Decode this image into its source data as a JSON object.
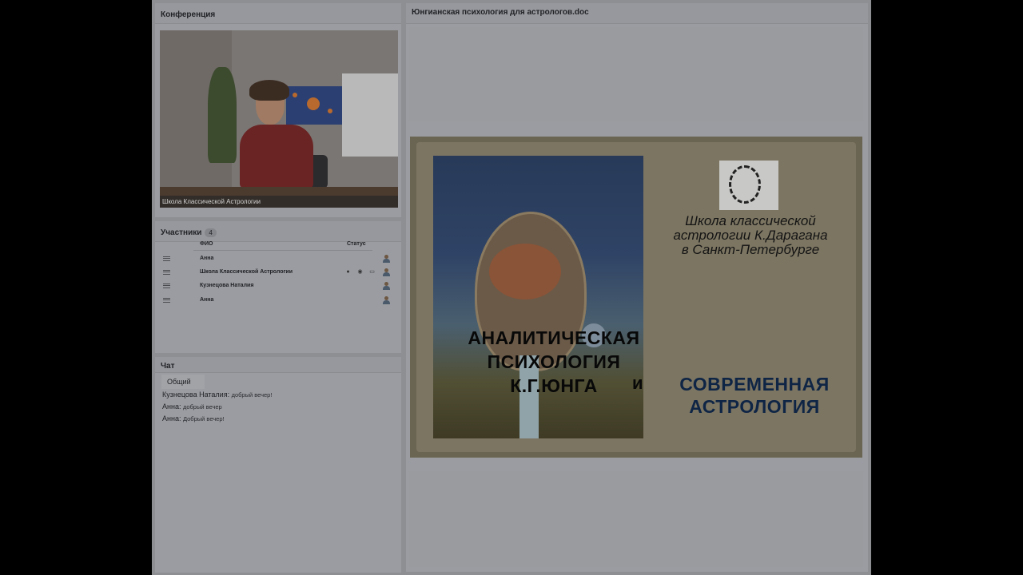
{
  "conference": {
    "title": "Конференция",
    "video_caption": "Школа Классической Астрологии"
  },
  "participants": {
    "title": "Участники",
    "count": "4",
    "col_name": "ФИО",
    "col_status": "Статус",
    "rows": [
      {
        "name": "Анна"
      },
      {
        "name": "Школа Классической Астрологии"
      },
      {
        "name": "Кузнецова Наталия"
      },
      {
        "name": "Анна"
      }
    ]
  },
  "chat": {
    "title": "Чат",
    "tab": "Общий",
    "messages": [
      {
        "author": "Кузнецова Наталия:",
        "text": "добрый вечер!"
      },
      {
        "author": "Анна:",
        "text": "добрый вечер"
      },
      {
        "author": "Анна:",
        "text": "Добрый вечер!"
      }
    ]
  },
  "document": {
    "title": "Юнгианская психология для астрологов.doc",
    "slide": {
      "school_line1": "Школа классической",
      "school_line2": "астрологии К.Дарагана",
      "school_line3": "в Санкт-Петербурге",
      "title1_line1": "АНАЛИТИЧЕСКАЯ",
      "title1_line2": "ПСИХОЛОГИЯ",
      "title1_line3": "К.Г.ЮНГА",
      "and": "и",
      "title2_line1": "СОВРЕМЕННАЯ",
      "title2_line2": "АСТРОЛОГИЯ"
    }
  },
  "icons": [
    "menu-icon",
    "user-icon",
    "microphone-icon",
    "webcam-icon",
    "screen-icon"
  ]
}
